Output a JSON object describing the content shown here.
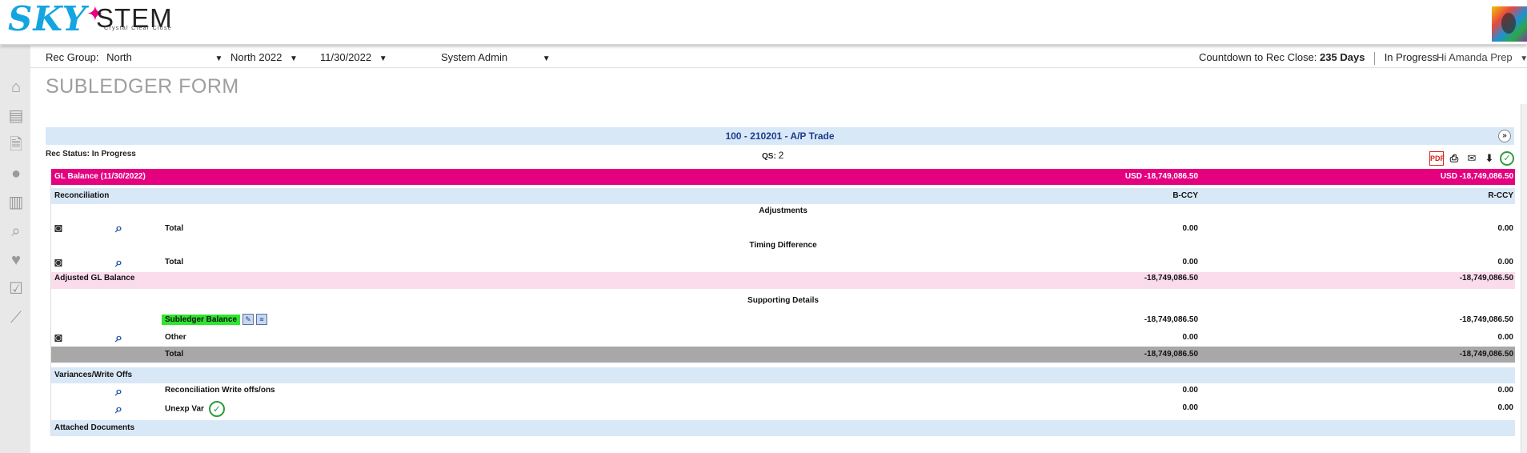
{
  "brand": {
    "logo_sky": "SKY",
    "logo_stem": "STEM",
    "tagline": "Crystal Clear Close"
  },
  "filters": {
    "rec_group_label": "Rec Group:",
    "rec_group_value": "North",
    "period_value": "North 2022",
    "date_value": "11/30/2022",
    "role_value": "System Admin",
    "countdown_label": "Countdown to Rec Close:",
    "countdown_value": "235 Days",
    "status": "In Progress",
    "user_greeting": "Hi Amanda Prep"
  },
  "sidebar": {
    "items": [
      "home-icon",
      "dashboard-icon",
      "file-upload-icon",
      "user-icon",
      "library-icon",
      "search-report-icon",
      "handshake-icon",
      "checklist-icon",
      "chart-icon"
    ]
  },
  "page": {
    "title": "SUBLEDGER FORM",
    "account": "100 - 210201 - A/P Trade",
    "rec_status": "Rec Status: In Progress",
    "qs_label": "QS:",
    "qs_value": "2",
    "tools": [
      "pdf-icon",
      "print-icon",
      "email-icon",
      "download-icon",
      "approve-icon"
    ],
    "tool_pdf_text": "PDF"
  },
  "form": {
    "gl_balance_label": "GL Balance (11/30/2022)",
    "gl_bccy": "USD -18,749,086.50",
    "gl_rccy": "USD -18,749,086.50",
    "reconciliation": "Reconciliation",
    "bccy_header": "B-CCY",
    "rccy_header": "R-CCY",
    "adjustments_title": "Adjustments",
    "adjustments_total_label": "Total",
    "adjustments_total_b": "0.00",
    "adjustments_total_r": "0.00",
    "timing_title": "Timing Difference",
    "timing_total_label": "Total",
    "timing_total_b": "0.00",
    "timing_total_r": "0.00",
    "adjusted_label": "Adjusted GL Balance",
    "adjusted_b": "-18,749,086.50",
    "adjusted_r": "-18,749,086.50",
    "supporting_title": "Supporting Details",
    "subledger_label": "Subledger Balance",
    "subledger_b": "-18,749,086.50",
    "subledger_r": "-18,749,086.50",
    "other_label": "Other",
    "other_b": "0.00",
    "other_r": "0.00",
    "support_total_label": "Total",
    "support_total_b": "-18,749,086.50",
    "support_total_r": "-18,749,086.50",
    "variances_label": "Variances/Write Offs",
    "writeoffs_label": "Reconciliation Write offs/ons",
    "writeoffs_b": "0.00",
    "writeoffs_r": "0.00",
    "unexp_label": "Unexp Var",
    "unexp_b": "0.00",
    "unexp_r": "0.00",
    "attached_label": "Attached Documents"
  },
  "colors": {
    "gl_bar": "#e4007f",
    "section_blue": "#d9e8f7",
    "adjusted_pink": "#fbdcec",
    "total_gray": "#a8a8a8",
    "highlight_green": "#2ee62e",
    "brand_blue": "#14a5e0"
  }
}
